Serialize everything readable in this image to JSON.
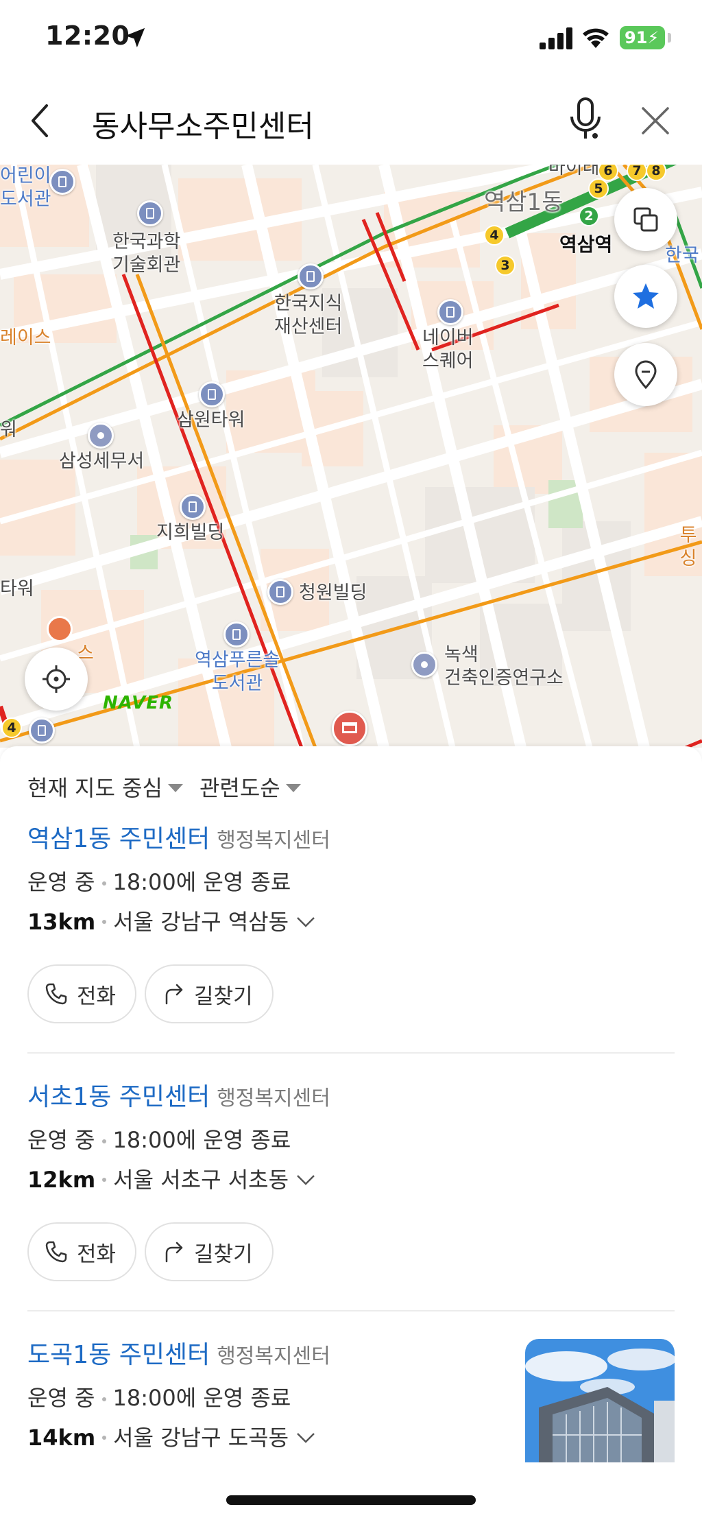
{
  "status_bar": {
    "time": "12:20",
    "battery": "91"
  },
  "search": {
    "query": "동사무소주민센터"
  },
  "map": {
    "labels": {
      "library_top": "어린이\n도서관",
      "kst": "한국과학\n기술회관",
      "kipo": "한국지식\n재산센터",
      "yeoksam1": "역삼1동",
      "yeoksam_station": "역삼역",
      "korea_right": "한국",
      "naver_square": "네이버\n스퀘어",
      "race": "레이스",
      "samwon": "삼원타워",
      "samsung_tax": "삼성세무서",
      "jihee": "지희빌딩",
      "cheongwon": "청원빌딩",
      "tower_left": "타워",
      "library_bottom": "역삼푸른솔\n도서관",
      "green_building": "녹색\n건축인증연구소",
      "tusu": "투싱",
      "cafe": "스",
      "left_edge": "워",
      "top_right_edge": "바이태"
    },
    "line_badges": [
      "5",
      "6",
      "7",
      "8",
      "4",
      "2",
      "3",
      "4"
    ],
    "logo": "NAVER"
  },
  "sheet": {
    "filter_center": "현재 지도 중심",
    "filter_sort": "관련도순",
    "results": [
      {
        "name": "역삼1동 주민센터",
        "category": "행정복지센터",
        "status": "운영 중",
        "hours": "18:00에 운영 종료",
        "distance": "13km",
        "address": "서울 강남구 역삼동"
      },
      {
        "name": "서초1동 주민센터",
        "category": "행정복지센터",
        "status": "운영 중",
        "hours": "18:00에 운영 종료",
        "distance": "12km",
        "address": "서울 서초구 서초동"
      },
      {
        "name": "도곡1동 주민센터",
        "category": "행정복지센터",
        "status": "운영 중",
        "hours": "18:00에 운영 종료",
        "distance": "14km",
        "address": "서울 강남구 도곡동"
      }
    ],
    "call_label": "전화",
    "directions_label": "길찾기"
  },
  "colors": {
    "link": "#1d6ac4",
    "favorite": "#1f6fe0",
    "subway_green": "#33a546",
    "subway_orange": "#f29a18",
    "road_red": "#e0231f",
    "naver_green": "#2db400"
  }
}
